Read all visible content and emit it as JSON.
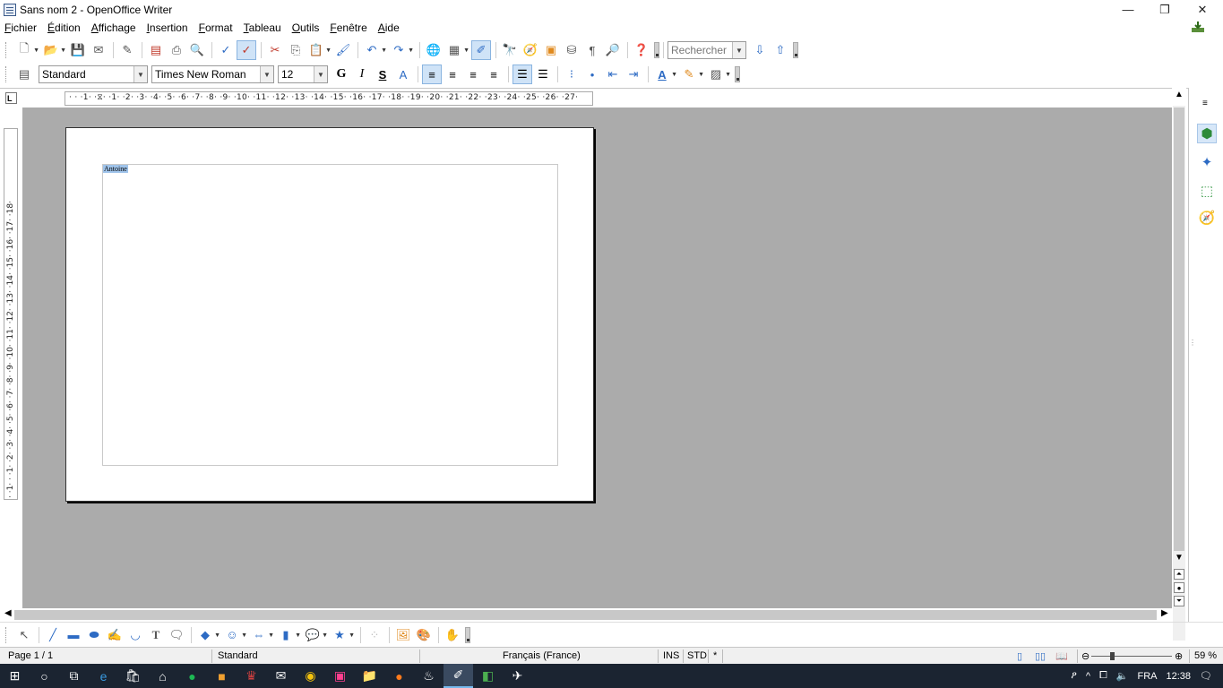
{
  "window": {
    "title": "Sans nom 2 - OpenOffice Writer",
    "minimize": "—",
    "restore": "❐",
    "close": "✕"
  },
  "menu": [
    "Fichier",
    "Édition",
    "Affichage",
    "Insertion",
    "Format",
    "Tableau",
    "Outils",
    "Fenêtre",
    "Aide"
  ],
  "toolbar": {
    "search_placeholder": "Rechercher",
    "paragraph_style": "Standard",
    "font_name": "Times New Roman",
    "font_size": "12",
    "bold_label": "G",
    "italic_label": "I",
    "underline_label": "S"
  },
  "ruler": {
    "horizontal": "· · ·1· ·⧖· ·1· ·2· ·3· ·4· ·5· ·6· ·7· ·8· ·9· ·10· ·11· ·12· ·13· ·14· ·15· ·16· ·17· ·18· ·19· ·20· ·21· ·22· ·23· ·24· ·25· ·26· ·27·",
    "vertical": "· ·1· · ·1· ·2· ·3· ·4· ·5· ·6· ·7· ·8· ·9· ·10· ·11· ·12· ·13· ·14· ·15· ·16· ·17· ·18·",
    "corner": "L"
  },
  "document": {
    "selected_text": "Antoine"
  },
  "status": {
    "page": "Page 1 / 1",
    "style": "Standard",
    "language": "Français (France)",
    "insert_mode": "INS",
    "selection_mode": "STD",
    "modified": "*",
    "zoom": "59 %"
  },
  "taskbar": {
    "language": "FRA",
    "time": "12:38"
  },
  "colors": {
    "selection": "#9fc3ea",
    "workspace": "#ababab",
    "taskbar": "#1b2431"
  }
}
